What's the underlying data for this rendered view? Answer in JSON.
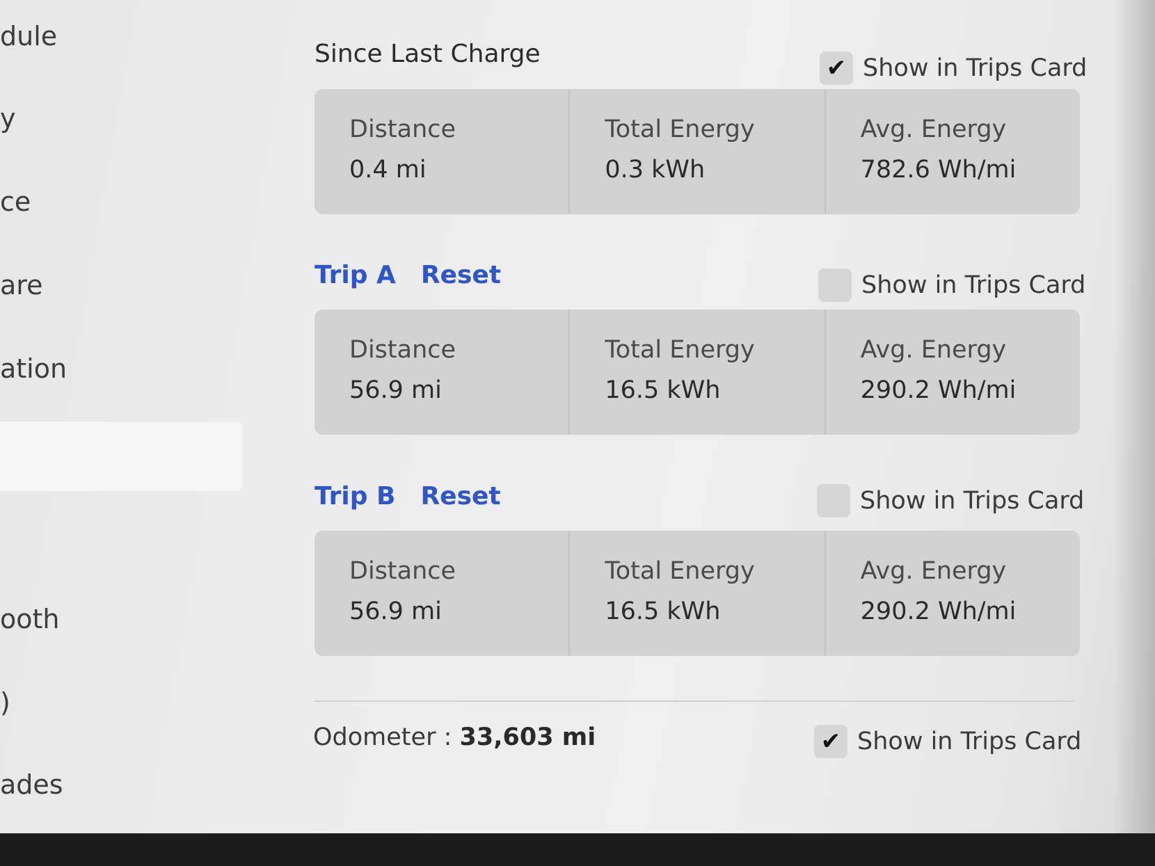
{
  "sidebar": {
    "items": [
      {
        "label": "dule"
      },
      {
        "label": "y"
      },
      {
        "label": "ce"
      },
      {
        "label": "are"
      },
      {
        "label": "ation"
      },
      {
        "label": ""
      },
      {
        "label": "ooth"
      },
      {
        "label": ")"
      },
      {
        "label": "ades"
      }
    ]
  },
  "since_last_charge": {
    "title": "Since Last Charge",
    "show_in_trips": {
      "label": "Show in Trips Card",
      "checked": true,
      "check_glyph": "✔"
    },
    "distance": {
      "label": "Distance",
      "value": "0.4  mi"
    },
    "total_energy": {
      "label": "Total Energy",
      "value": "0.3  kWh"
    },
    "avg_energy": {
      "label": "Avg. Energy",
      "value": "782.6  Wh/mi"
    }
  },
  "trip_a": {
    "title": "Trip A",
    "reset_label": "Reset",
    "show_in_trips": {
      "label": "Show in Trips Card",
      "checked": false
    },
    "distance": {
      "label": "Distance",
      "value": "56.9  mi"
    },
    "total_energy": {
      "label": "Total Energy",
      "value": "16.5  kWh"
    },
    "avg_energy": {
      "label": "Avg. Energy",
      "value": "290.2  Wh/mi"
    }
  },
  "trip_b": {
    "title": "Trip B",
    "reset_label": "Reset",
    "show_in_trips": {
      "label": "Show in Trips Card",
      "checked": false
    },
    "distance": {
      "label": "Distance",
      "value": "56.9  mi"
    },
    "total_energy": {
      "label": "Total Energy",
      "value": "16.5  kWh"
    },
    "avg_energy": {
      "label": "Avg. Energy",
      "value": "290.2  Wh/mi"
    }
  },
  "odometer": {
    "label": "Odometer  :",
    "value": "33,603  mi",
    "show_in_trips": {
      "label": "Show in Trips Card",
      "checked": true,
      "check_glyph": "✔"
    }
  },
  "colors": {
    "link_blue": "#2f56c9",
    "card_bg": "#d2d2d2",
    "checkbox_bg": "#d6d6d6"
  }
}
